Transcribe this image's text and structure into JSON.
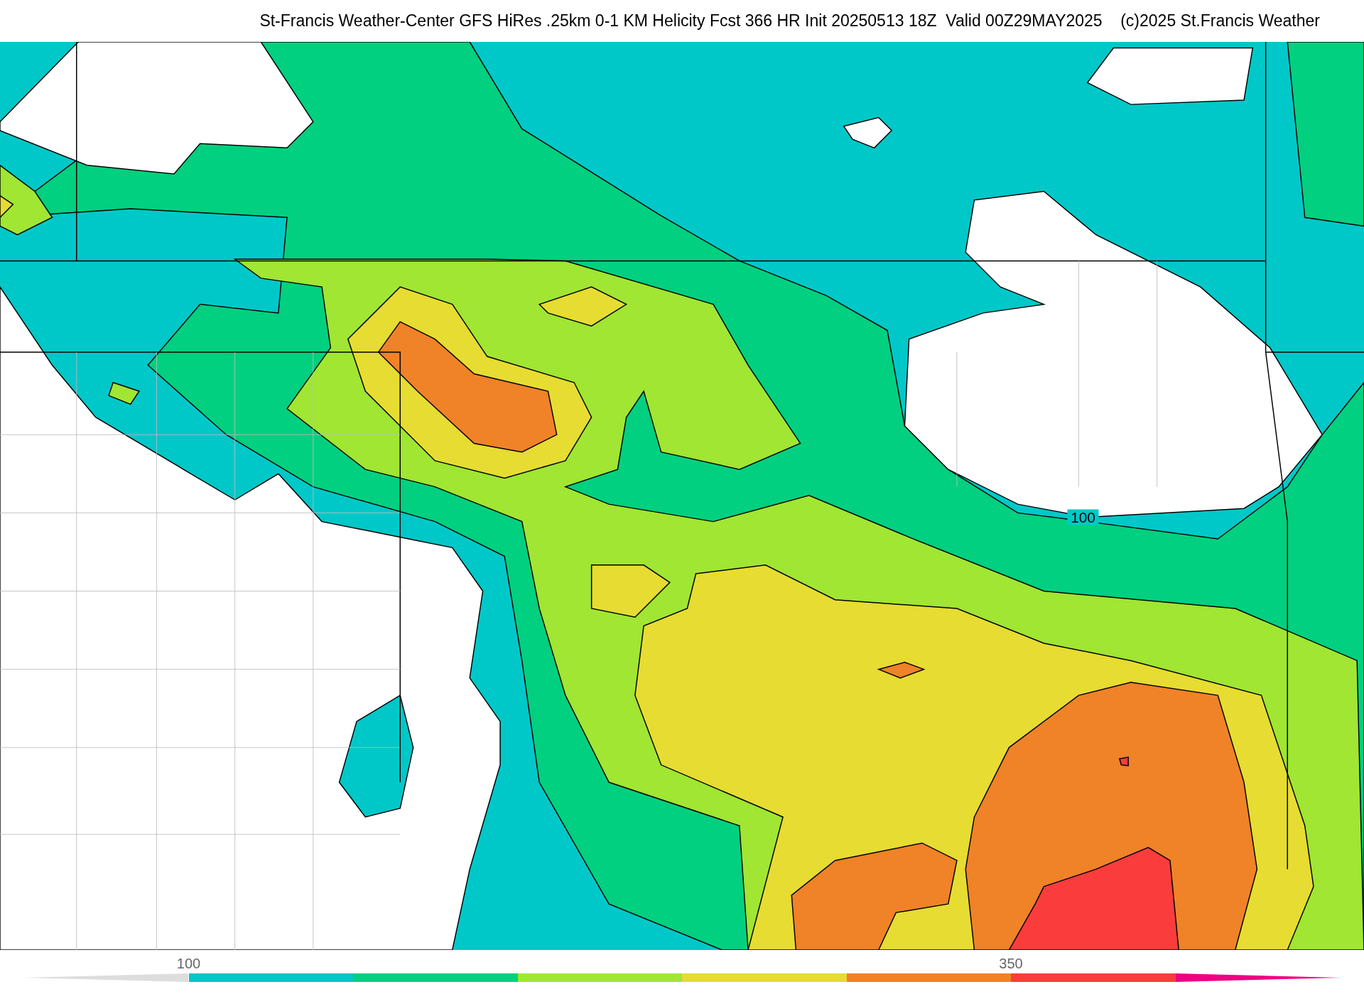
{
  "title": "St-Francis Weather-Center GFS HiRes .25km 0-1 KM Helicity Fcst 366 HR Init 20250513 18Z  Valid 00Z29MAY2025    (c)2025 St.Francis Weather",
  "map": {
    "contour_labels": [
      "100"
    ]
  },
  "colorbar": {
    "low_cap": {
      "color": "#dddddd"
    },
    "segments": [
      {
        "color": "#00c8c8",
        "tick": "100"
      },
      {
        "color": "#00d080"
      },
      {
        "color": "#a0e632"
      },
      {
        "color": "#e6dc32"
      },
      {
        "color": "#f08228"
      },
      {
        "color": "#fa3c3c",
        "tick": "350"
      }
    ],
    "high_cap": {
      "color": "#f00082"
    }
  }
}
